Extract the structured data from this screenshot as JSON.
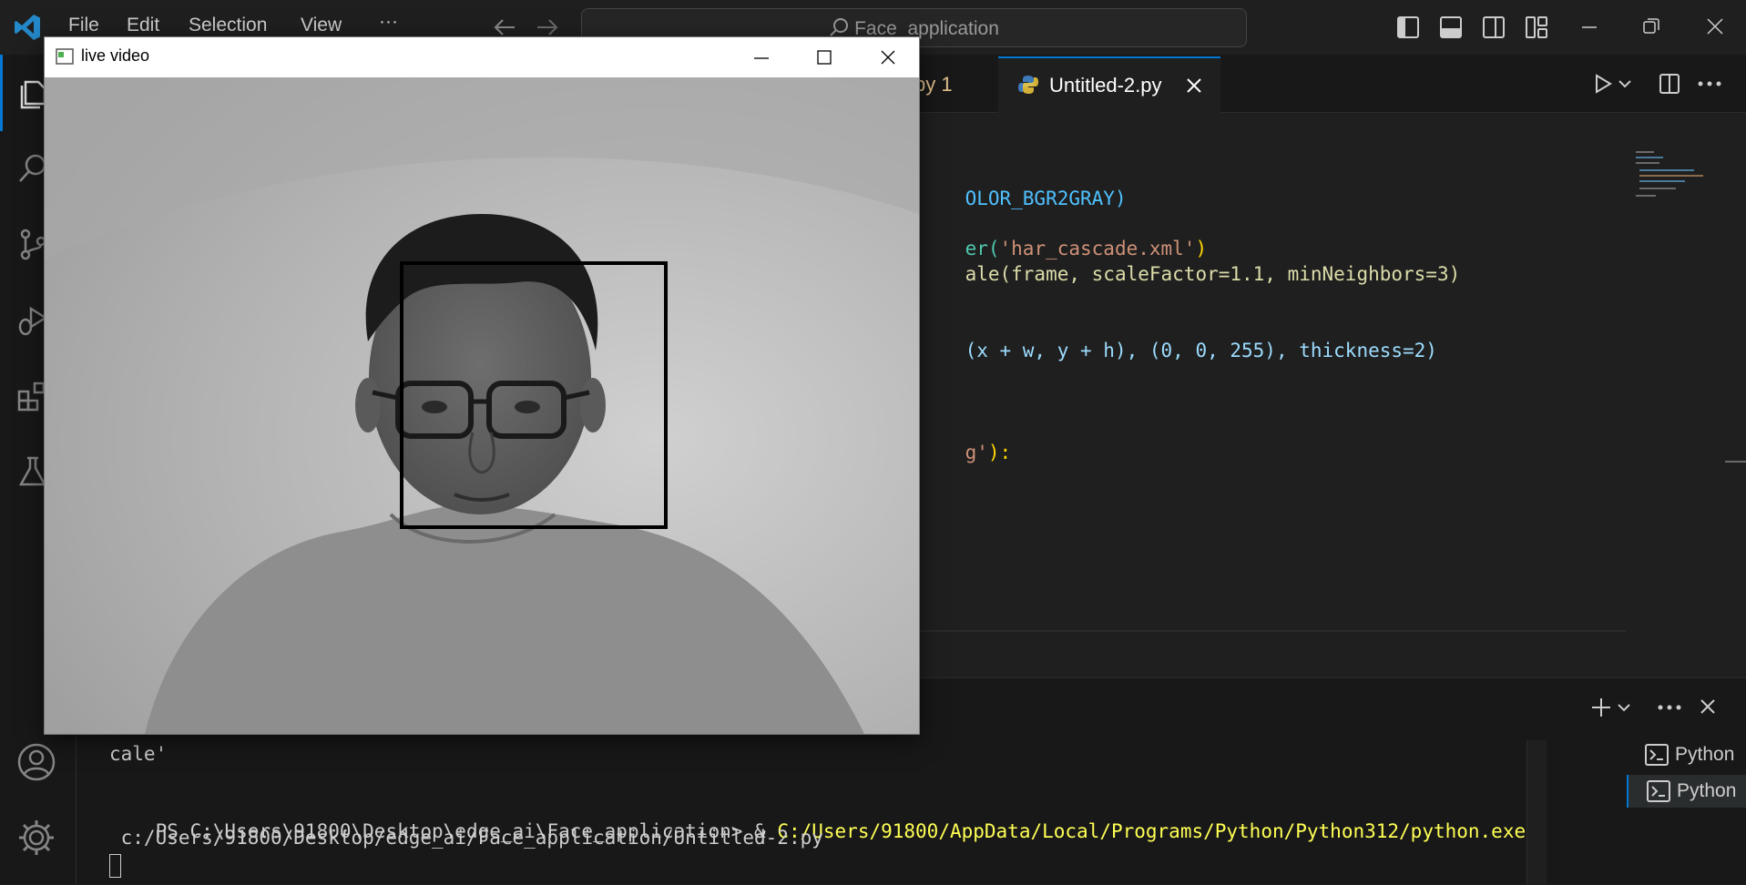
{
  "menu": {
    "file": "File",
    "edit": "Edit",
    "selection": "Selection",
    "view": "View",
    "more": "···"
  },
  "search": {
    "text": "Face_application"
  },
  "tabs": {
    "partial": "py 1",
    "active": "Untitled-2.py"
  },
  "code": {
    "line1": "OLOR_BGR2GRAY)",
    "line2_fn": "er(",
    "line2_str": "'har_cascade.xml'",
    "line2_close": ")",
    "line3": "ale(frame, scaleFactor=1.1, minNeighbors=3)",
    "line4": "(x + w, y + h), (0, 0, 255), thickness=2)",
    "line5_str": "g'",
    "line5_rest": "):"
  },
  "terminal": {
    "line1": "cale'",
    "line2_prompt": "PS C:\\Users\\91800\\Desktop\\edge_ai\\Face_application> & ",
    "line2_exe": "C:/Users/91800/AppData/Local/Programs/Python/Python312/python.exe",
    "line3": " c:/Users/91800/Desktop/edge_ai/Face_application/Untitled-2.py",
    "sessions": [
      "Python",
      "Python"
    ]
  },
  "video_window": {
    "title": "live video"
  },
  "colors": {
    "accent": "#0078d4",
    "background": "#1f1f1f",
    "string": "#ce9178",
    "exe_path": "#ffff55"
  }
}
